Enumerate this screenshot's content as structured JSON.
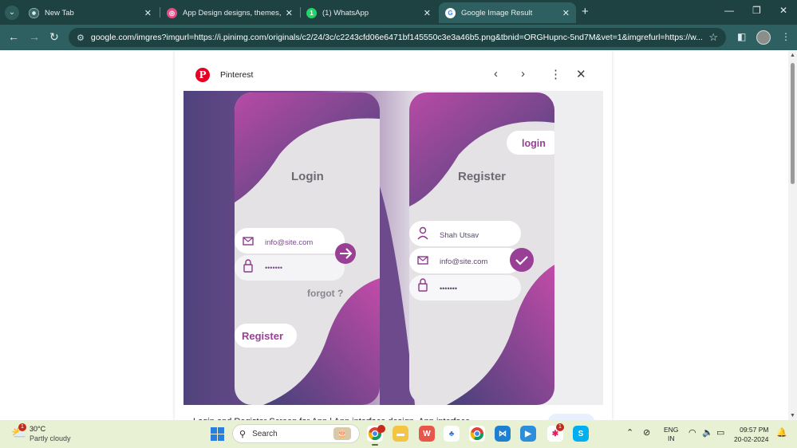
{
  "browser": {
    "tabs": [
      {
        "title": "New Tab",
        "favicon": "chrome-icon",
        "active": false
      },
      {
        "title": "App Design designs, themes, te",
        "favicon": "dribbble-icon",
        "active": false
      },
      {
        "title": "(1) WhatsApp",
        "favicon": "whatsapp-icon",
        "active": false
      },
      {
        "title": "Google Image Result",
        "favicon": "google-icon",
        "active": true
      }
    ],
    "url": "google.com/imgres?imgurl=https://i.pinimg.com/originals/c2/24/3c/c2243cfd06e6471bf145550c3e3a46b5.png&tbnid=ORGHupnc-5nd7M&vet=1&imgrefurl=https://w...",
    "colors": {
      "tabbar": "#1e4142",
      "toolbar": "#2f6061"
    }
  },
  "viewer": {
    "source": "Pinterest",
    "caption": "Login and Register Screen for App | App interface design, App interface"
  },
  "mockup": {
    "login_title": "Login",
    "register_title": "Register",
    "email": "info@site.com",
    "password": "•••••••",
    "forgot": "forgot ?",
    "register_button": "Register",
    "login_button": "login",
    "name": "Shah Utsav",
    "colors": {
      "purple_dark": "#4a4077",
      "magenta": "#b5479f",
      "card": "#e4e2e5"
    }
  },
  "taskbar": {
    "temp": "30°C",
    "condition": "Partly cloudy",
    "weather_badge": "1",
    "search_label": "Search",
    "lang_line1": "ENG",
    "lang_line2": "IN",
    "time": "09:57 PM",
    "date": "20-02-2024",
    "chrome_badge": "",
    "slack_badge": "1"
  }
}
